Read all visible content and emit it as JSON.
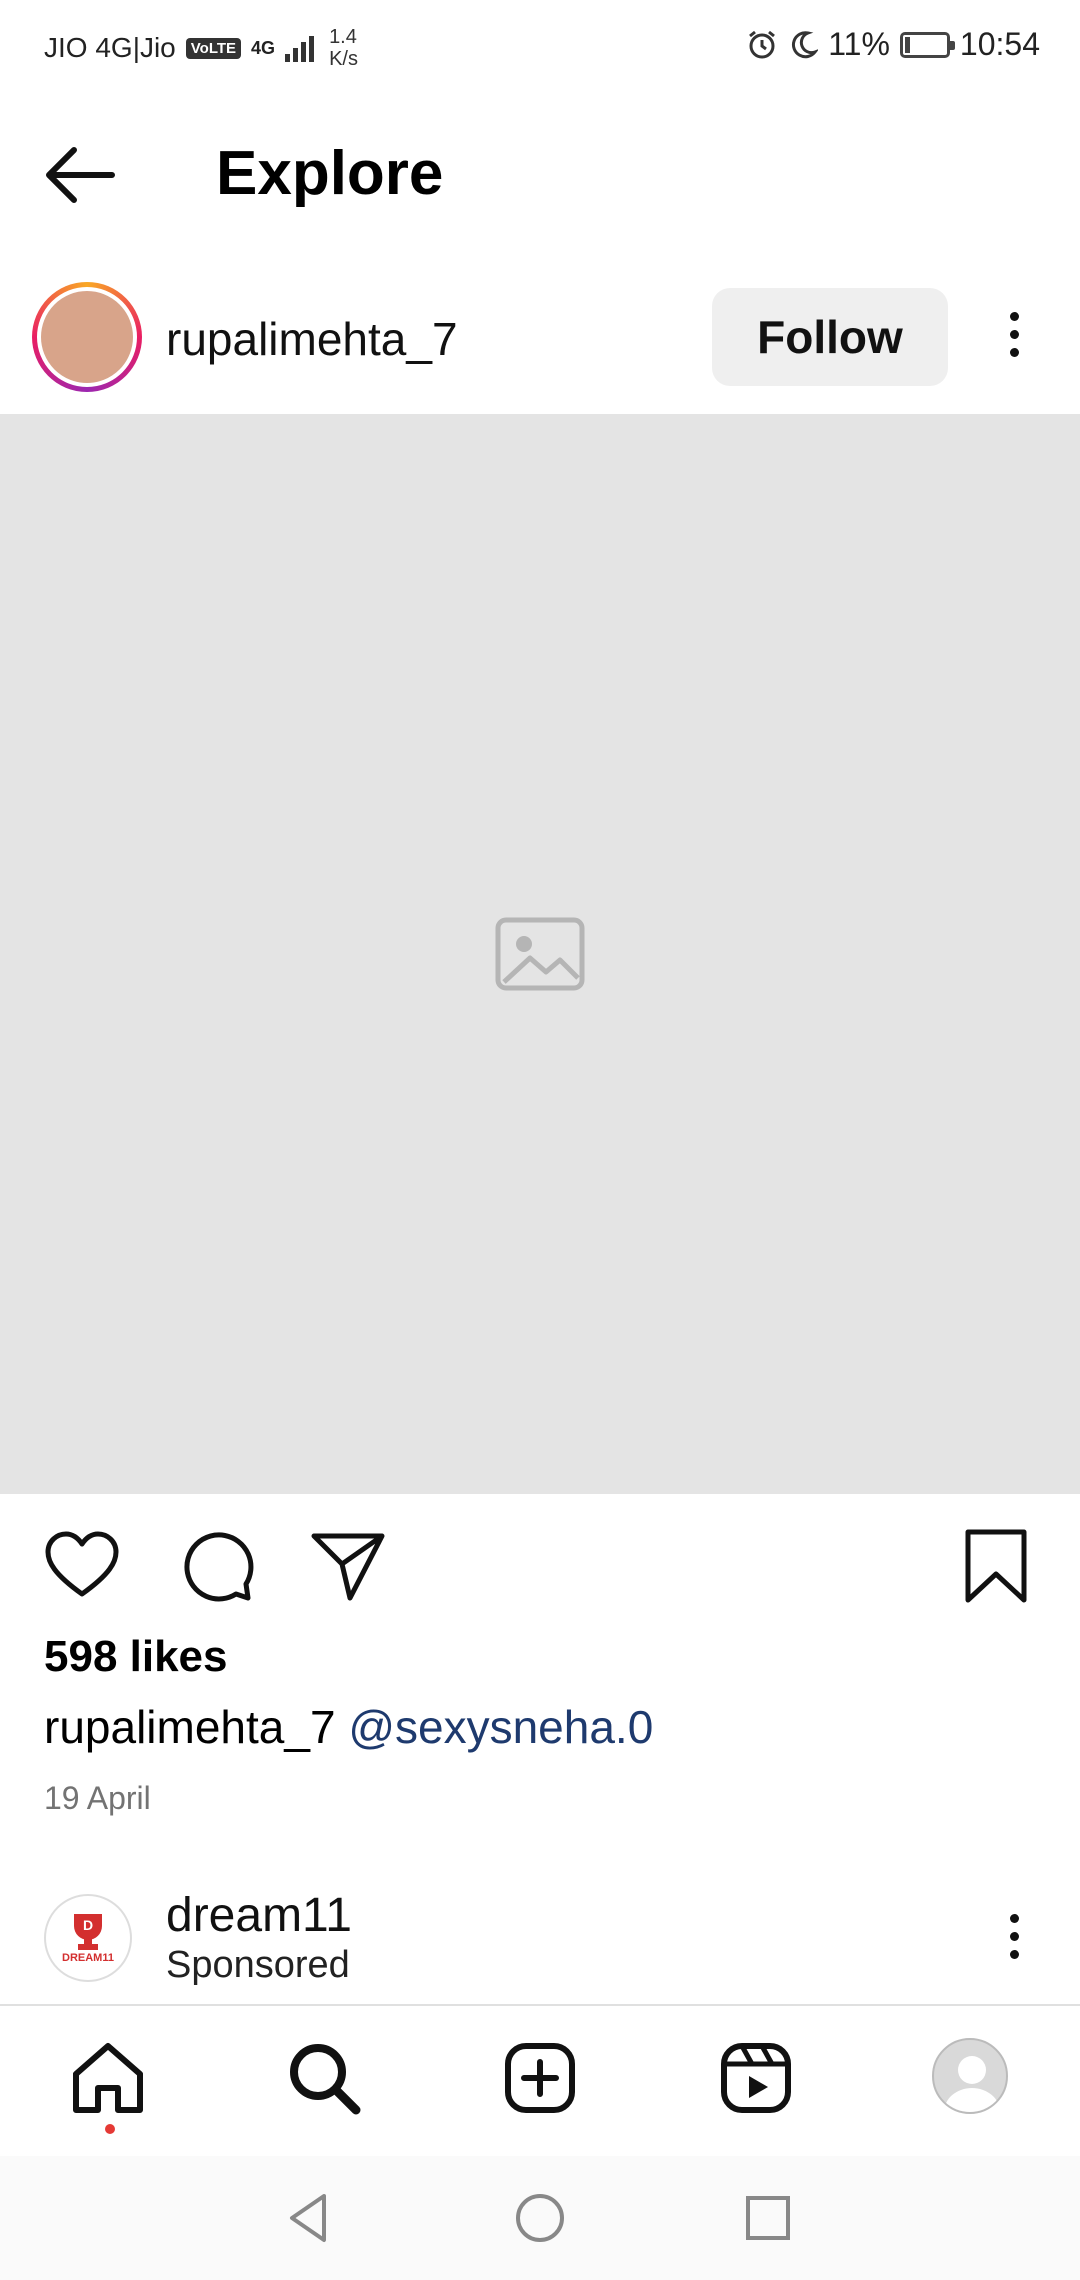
{
  "status_bar": {
    "carrier": "JIO 4G|Jio",
    "volte": "VoLTE",
    "network_type": "4G",
    "speed_value": "1.4",
    "speed_unit": "K/s",
    "battery": "11%",
    "battery_level": 0.11,
    "time": "10:54",
    "icons": [
      "alarm-icon",
      "moon-icon",
      "battery-icon",
      "signal-icon"
    ]
  },
  "header": {
    "title": "Explore",
    "back_icon": "arrow-left-icon"
  },
  "post": {
    "username": "rupalimehta_7",
    "follow_label": "Follow",
    "more_icon": "more-vertical-icon",
    "image": "post-photo-placeholder",
    "likes": "598 likes",
    "caption_user": "rupalimehta_7",
    "caption_mention": "@sexysneha.0",
    "date": "19 April",
    "actions": [
      "heart-icon",
      "comment-icon",
      "share-icon",
      "bookmark-icon"
    ]
  },
  "sponsored": {
    "name": "dream11",
    "label": "Sponsored",
    "logo_text": "DREAM11",
    "more_icon": "more-vertical-icon",
    "brand_color": "#d32f2f"
  },
  "bottom_nav": {
    "items": [
      "home-icon",
      "search-icon",
      "create-post-icon",
      "reels-icon",
      "profile-avatar"
    ],
    "active_dot_color": "#e53935"
  },
  "system_nav": [
    "back-triangle-icon",
    "home-circle-icon",
    "recents-square-icon"
  ]
}
